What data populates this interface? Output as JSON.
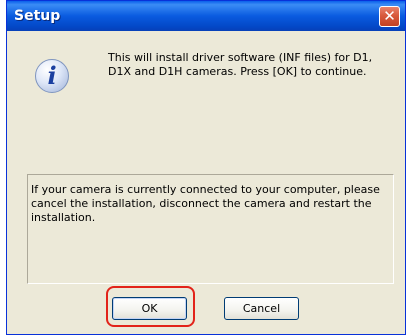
{
  "window": {
    "title": "Setup",
    "close_glyph": "✕"
  },
  "icon": {
    "name": "info-icon",
    "glyph": "i"
  },
  "message": "This will install driver software (INF files) for D1, D1X and D1H cameras. Press [OK] to continue.",
  "notice": "If your camera is currently connected to your computer, please cancel the installation, disconnect the camera and restart the installation.",
  "buttons": {
    "ok": "OK",
    "cancel": "Cancel"
  },
  "colors": {
    "titlebar": "#0A5BE0",
    "dialog_bg": "#ECE9D8",
    "close_button": "#D8593C",
    "highlight": "#E2231A"
  }
}
